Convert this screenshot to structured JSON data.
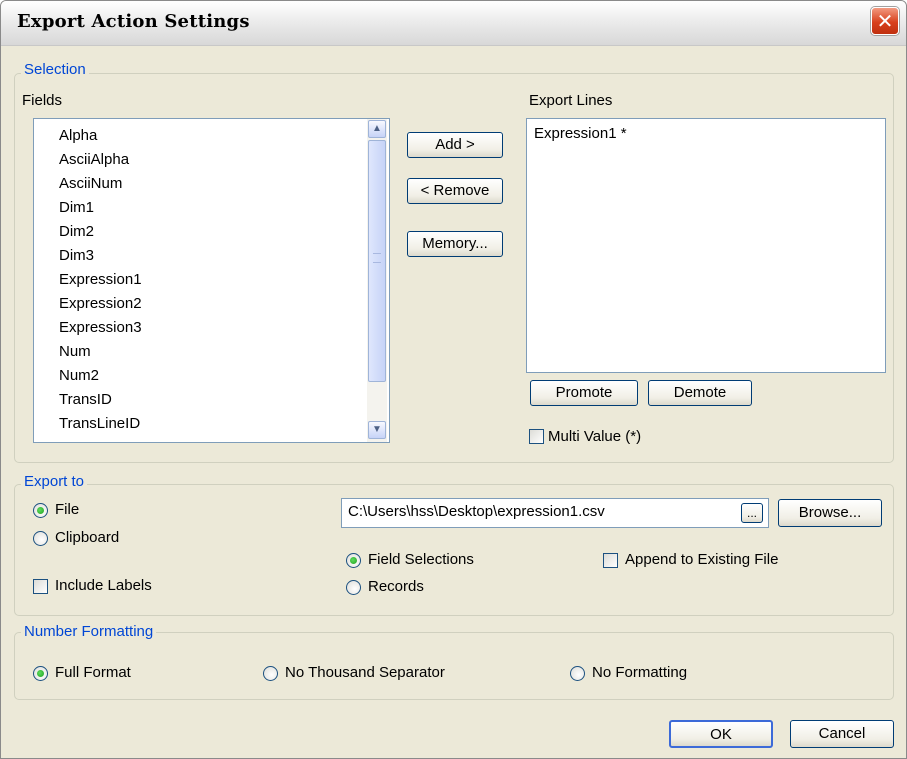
{
  "window": {
    "title": "Export Action Settings",
    "close_glyph": "✕"
  },
  "selection": {
    "legend": "Selection",
    "fields_label": "Fields",
    "fields": [
      "Alpha",
      "AsciiAlpha",
      "AsciiNum",
      "Dim1",
      "Dim2",
      "Dim3",
      "Expression1",
      "Expression2",
      "Expression3",
      "Num",
      "Num2",
      "TransID",
      "TransLineID"
    ],
    "add_button": "Add >",
    "remove_button": "< Remove",
    "memory_button": "Memory...",
    "export_lines_label": "Export Lines",
    "export_lines": [
      "Expression1 *"
    ],
    "promote_button": "Promote",
    "demote_button": "Demote",
    "multi_value_label": "Multi Value (*)",
    "multi_value_checked": false
  },
  "export_to": {
    "legend": "Export to",
    "file_label": "File",
    "file_selected": true,
    "clipboard_label": "Clipboard",
    "include_labels_label": "Include Labels",
    "include_labels_checked": false,
    "path_value": "C:\\Users\\hss\\Desktop\\expression1.csv",
    "ellipsis_button": "...",
    "browse_button": "Browse...",
    "field_selections_label": "Field Selections",
    "field_selections_selected": true,
    "records_label": "Records",
    "append_label": "Append to Existing File",
    "append_checked": false
  },
  "number_formatting": {
    "legend": "Number Formatting",
    "full_format_label": "Full Format",
    "full_format_selected": true,
    "no_thousand_label": "No Thousand Separator",
    "no_formatting_label": "No Formatting"
  },
  "footer": {
    "ok_button": "OK",
    "cancel_button": "Cancel"
  }
}
